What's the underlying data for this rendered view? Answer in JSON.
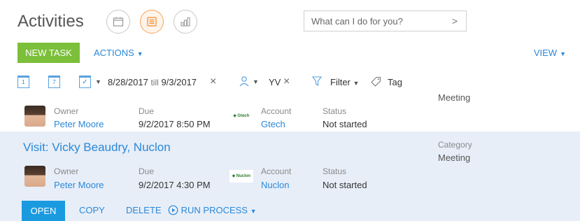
{
  "header": {
    "title": "Activities",
    "views": [
      {
        "icon": "calendar-icon",
        "active": false
      },
      {
        "icon": "list-icon",
        "active": true
      },
      {
        "icon": "analytics-icon",
        "active": false
      }
    ],
    "search_placeholder": "What can I do for you?"
  },
  "toolbar": {
    "new_task": "NEW TASK",
    "actions": "ACTIONS",
    "view": "VIEW"
  },
  "filters": {
    "day_badge": "1",
    "week_badge": "7",
    "date_range_start": "8/28/2017",
    "date_range_till": "till",
    "date_range_end": "9/3/2017",
    "owner": "YV",
    "filter_label": "Filter",
    "tag_label": "Tag"
  },
  "activities": [
    {
      "title": "",
      "category_label": "",
      "category_value": "Meeting",
      "owner_label": "Owner",
      "owner_value": "Peter Moore",
      "due_label": "Due",
      "due_value": "9/2/2017 8:50 PM",
      "account_logo": "Gtech",
      "account_label": "Account",
      "account_value": "Gtech",
      "status_label": "Status",
      "status_value": "Not started"
    },
    {
      "title": "Visit: Vicky Beaudry, Nuclon",
      "category_label": "Category",
      "category_value": "Meeting",
      "owner_label": "Owner",
      "owner_value": "Peter Moore",
      "due_label": "Due",
      "due_value": "9/2/2017 4:30 PM",
      "account_logo": "Nuclon",
      "account_label": "Account",
      "account_value": "Nuclon",
      "status_label": "Status",
      "status_value": "Not started"
    }
  ],
  "row_actions": {
    "open": "OPEN",
    "copy": "COPY",
    "delete": "DELETE",
    "run_process": "RUN PROCESS"
  },
  "colors": {
    "accent": "#2b88d8",
    "new_task": "#7bbf3a",
    "open": "#1a9be0",
    "selected_row": "#e7eef8"
  }
}
